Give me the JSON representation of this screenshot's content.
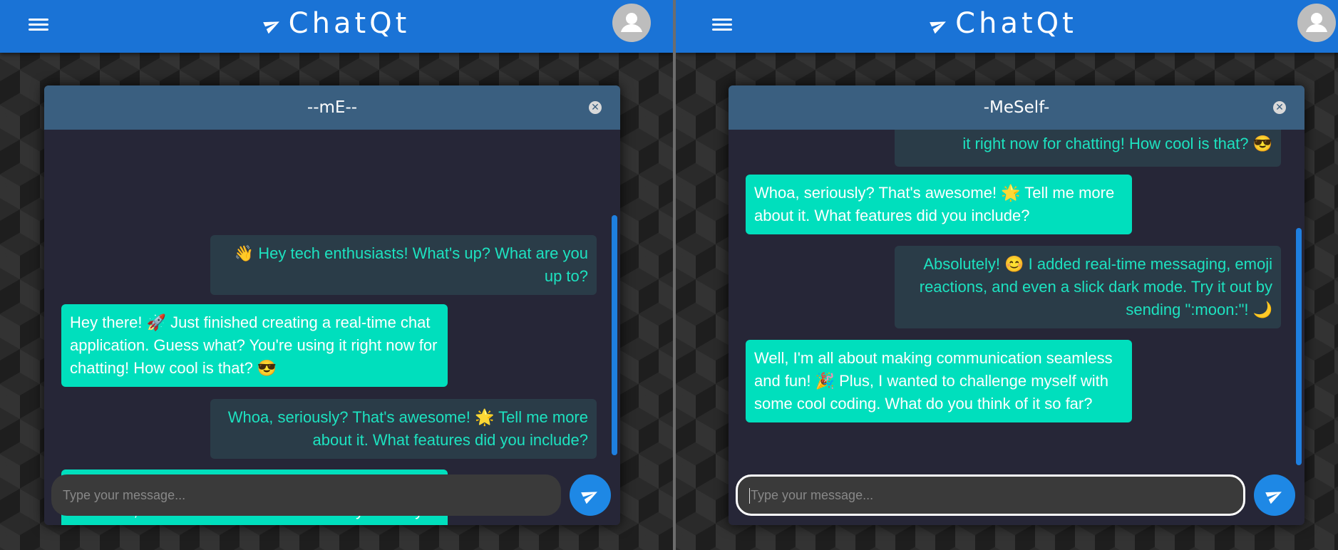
{
  "app": {
    "title": "ChatQt",
    "brand_color": "#1a73d6",
    "icons": {
      "menu": "hamburger-menu-icon",
      "brand": "paper-plane-icon",
      "avatar": "user-avatar-icon",
      "send": "paper-plane-icon",
      "close": "close-icon"
    }
  },
  "left": {
    "chat_title": "--mE--",
    "input_placeholder": "Type your message...",
    "messages": [
      {
        "dir": "out",
        "text": "👋 Hey tech enthusiasts! What's up? What are you up to?"
      },
      {
        "dir": "in",
        "text": "Hey there! 🚀 Just finished creating a real-time chat application. Guess what? You're using it right now for chatting! How cool is that? 😎"
      },
      {
        "dir": "out",
        "text": "Whoa, seriously? That's awesome! 🌟 Tell me more about it. What features did you include?"
      },
      {
        "dir": "in",
        "text": "Absolutely! 😊 I added real-time messaging, emoji reactions, and even a slick dark mode. Try it out by sending \":moon:\"! 🌙"
      }
    ]
  },
  "right": {
    "chat_title": "-MeSelf-",
    "input_placeholder": "Type your message...",
    "messages": [
      {
        "dir": "out",
        "text": "it right now for chatting! How cool is that? 😎"
      },
      {
        "dir": "in",
        "text": "Whoa, seriously? That's awesome! 🌟 Tell me more about it. What features did you include?"
      },
      {
        "dir": "out",
        "text": "Absolutely! 😊 I added real-time messaging, emoji reactions, and even a slick dark mode. Try it out by sending \":moon:\"! 🌙"
      },
      {
        "dir": "in",
        "text": "Well, I'm all about making communication seamless and fun! 🎉 Plus, I wanted to challenge myself with some cool coding. What do you think of it so far?"
      }
    ]
  }
}
